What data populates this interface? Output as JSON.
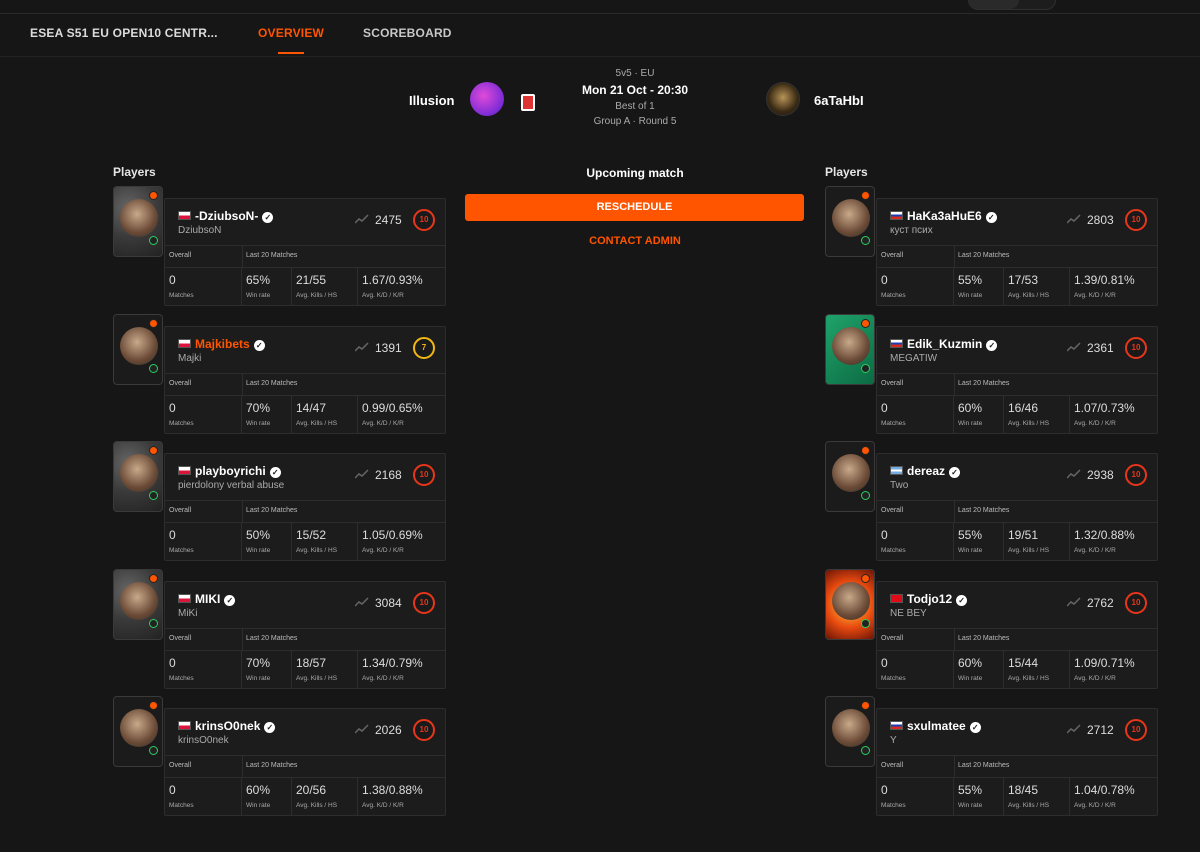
{
  "tabs": {
    "title": "ESEA S51 EU OPEN10 CENTR...",
    "overview": "OVERVIEW",
    "scoreboard": "SCOREBOARD"
  },
  "match": {
    "team_left": "Illusion",
    "team_right": "6aTaHbI",
    "format": "5v5 · EU",
    "datetime": "Mon 21 Oct - 20:30",
    "best_of": "Best of 1",
    "group": "Group A · Round 5",
    "status": "Upcoming match",
    "reschedule": "RESCHEDULE",
    "contact_admin": "CONTACT ADMIN"
  },
  "labels": {
    "players": "Players",
    "overall": "Overall",
    "last20": "Last 20 Matches",
    "matches": "Matches",
    "winrate": "Win rate",
    "kills_hs": "Avg. Kills / HS",
    "kd_kr": "Avg. K/D / K/R"
  },
  "colors": {
    "accent": "#ff5500",
    "level10": "#e8361a",
    "level7": "#f2b711"
  },
  "left_players": [
    {
      "nick": "-DziubsoN-",
      "sub": "DziubsoN",
      "flag": "pl",
      "elo": "2475",
      "level": "10",
      "matches": "0",
      "winrate": "65%",
      "kills": "21/55",
      "kd": "1.67/0.93%"
    },
    {
      "nick": "Majkibets",
      "sub": "Majki",
      "flag": "pl",
      "elo": "1391",
      "level": "7",
      "matches": "0",
      "winrate": "70%",
      "kills": "14/47",
      "kd": "0.99/0.65%"
    },
    {
      "nick": "playboyrichi",
      "sub": "pierdolony verbal abuse",
      "flag": "pl",
      "elo": "2168",
      "level": "10",
      "matches": "0",
      "winrate": "50%",
      "kills": "15/52",
      "kd": "1.05/0.69%"
    },
    {
      "nick": "MIKI",
      "sub": "MiKi",
      "flag": "pl",
      "elo": "3084",
      "level": "10",
      "matches": "0",
      "winrate": "70%",
      "kills": "18/57",
      "kd": "1.34/0.79%"
    },
    {
      "nick": "krinsO0nek",
      "sub": "krinsO0nek",
      "flag": "pl",
      "elo": "2026",
      "level": "10",
      "matches": "0",
      "winrate": "60%",
      "kills": "20/56",
      "kd": "1.38/0.88%"
    }
  ],
  "right_players": [
    {
      "nick": "HaKa3aHuE6",
      "sub": "куст псих",
      "flag": "ru",
      "elo": "2803",
      "level": "10",
      "matches": "0",
      "winrate": "55%",
      "kills": "17/53",
      "kd": "1.39/0.81%"
    },
    {
      "nick": "Edik_Kuzmin",
      "sub": "MEGATIW",
      "flag": "ru",
      "elo": "2361",
      "level": "10",
      "matches": "0",
      "winrate": "60%",
      "kills": "16/46",
      "kd": "1.07/0.73%"
    },
    {
      "nick": "dereaz",
      "sub": "Two",
      "flag": "ar",
      "elo": "2938",
      "level": "10",
      "matches": "0",
      "winrate": "55%",
      "kills": "19/51",
      "kd": "1.32/0.88%"
    },
    {
      "nick": "Todjo12",
      "sub": "NE BEY",
      "flag": "tr",
      "elo": "2762",
      "level": "10",
      "matches": "0",
      "winrate": "60%",
      "kills": "15/44",
      "kd": "1.09/0.71%"
    },
    {
      "nick": "sxulmatee",
      "sub": "Y",
      "flag": "ru",
      "elo": "2712",
      "level": "10",
      "matches": "0",
      "winrate": "55%",
      "kills": "18/45",
      "kd": "1.04/0.78%"
    }
  ]
}
